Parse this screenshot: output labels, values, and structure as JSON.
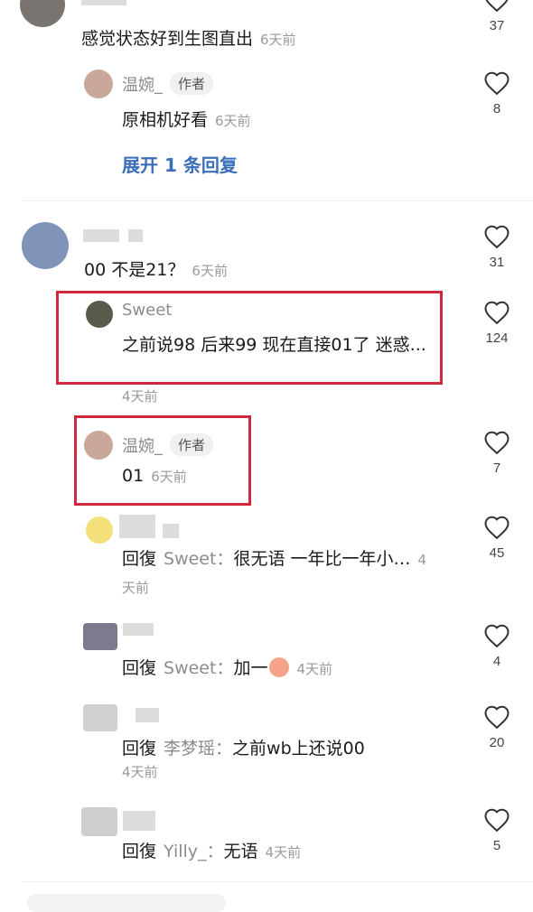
{
  "colors": {
    "highlight": "#d0293b",
    "link": "#3a6fb8",
    "muted": "#9a9a9a"
  },
  "comments": [
    {
      "text": "感觉状态好到生图直出",
      "time": "6天前",
      "likes": "37"
    },
    {
      "author": "温婉_",
      "badge": "作者",
      "text": "原相机好看",
      "time": "6天前",
      "likes": "8"
    },
    {
      "expand": "展开 1 条回复"
    },
    {
      "text": "00 不是21？",
      "time": "6天前",
      "likes": "31"
    },
    {
      "author": "Sweet",
      "text": "之前说98 后来99 现在直接01了 迷惑...",
      "time": "4天前",
      "likes": "124"
    },
    {
      "author": "温婉_",
      "badge": "作者",
      "text": "01",
      "time": "6天前",
      "likes": "7"
    },
    {
      "reply_kw": "回復",
      "reply_to": "Sweet：",
      "text": "很无语 一年比一年小…",
      "time": "4天前",
      "likes": "45"
    },
    {
      "reply_kw": "回復",
      "reply_to": "Sweet：",
      "text": "加一",
      "time": "4天前",
      "likes": "4"
    },
    {
      "reply_kw": "回復",
      "reply_to": "李梦瑶：",
      "text": "之前wb上还说00",
      "time": "4天前",
      "likes": "20"
    },
    {
      "reply_kw": "回復",
      "reply_to": "Yilly_：",
      "text": "无语",
      "time": "4天前",
      "likes": "5"
    }
  ]
}
